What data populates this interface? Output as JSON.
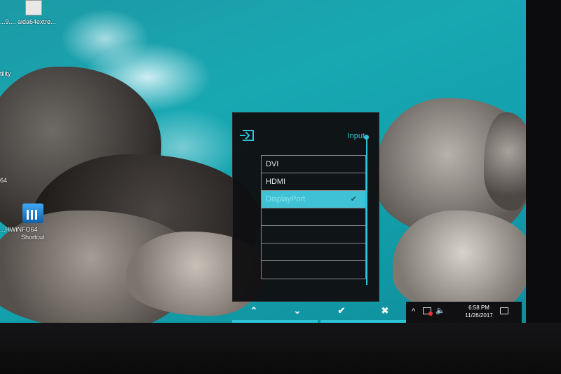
{
  "desktop": {
    "icons": [
      {
        "label": "...9....  aida64extre..."
      },
      {
        "label": "tility"
      },
      {
        "label": "64"
      },
      {
        "label_1": "...HWiNFO64",
        "label_2": "Shortcut"
      }
    ]
  },
  "osd": {
    "title": "Input",
    "icon": "input-source-icon",
    "items": [
      {
        "label": "DVI"
      },
      {
        "label": "HDMI"
      },
      {
        "label": "DisplayPort",
        "check": "✔"
      },
      {
        "label": ""
      },
      {
        "label": ""
      },
      {
        "label": ""
      },
      {
        "label": ""
      }
    ],
    "selected_index": 2,
    "buttons": [
      {
        "name": "up",
        "glyph": "⌃"
      },
      {
        "name": "down",
        "glyph": "⌄"
      },
      {
        "name": "confirm",
        "glyph": "✔"
      },
      {
        "name": "close",
        "glyph": "✖"
      }
    ]
  },
  "taskbar": {
    "chevron": "^",
    "volume_glyph": "🔈",
    "time": "6:58 PM",
    "date": "11/26/2017"
  },
  "colors": {
    "accent": "#2ec4d6",
    "selected": "#40c2d6",
    "panel": "#100f11"
  }
}
